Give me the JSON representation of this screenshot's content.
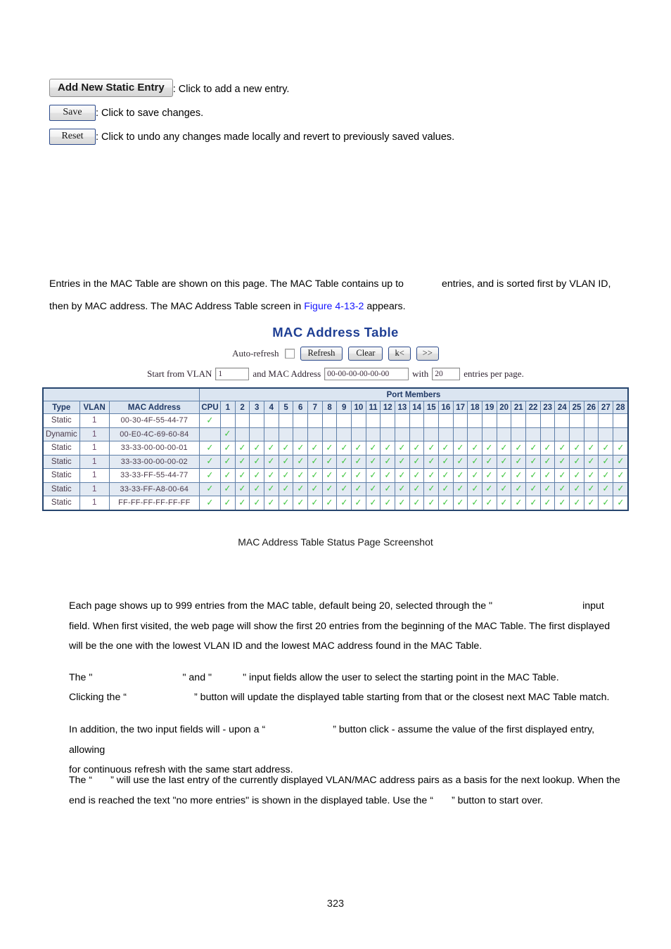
{
  "legend": {
    "items": [
      {
        "button": "Add New Static Entry",
        "style": "classic",
        "desc": ": Click to add a new entry."
      },
      {
        "button": "Save",
        "style": "web",
        "desc": ": Click to save changes."
      },
      {
        "button": "Reset",
        "style": "web",
        "desc": ": Click to undo any changes made locally and revert to previously saved values."
      }
    ]
  },
  "intro": {
    "part1": "Entries in the MAC Table are shown on this page. The MAC Table contains up to",
    "part2": "entries, and is sorted first by VLAN ID,",
    "part3": "then by MAC address. The MAC Address Table screen in",
    "figure_ref": "Figure 4-13-2",
    "part4": "appears."
  },
  "screenshot": {
    "title": "MAC Address Table",
    "controls": {
      "auto_refresh_label": "Auto-refresh",
      "auto_refresh_checked": false,
      "refresh_label": "Refresh",
      "clear_label": "Clear",
      "first_label": "k<",
      "next_label": ">>"
    },
    "filter": {
      "start_label": "Start from VLAN",
      "vlan_value": "1",
      "and_mac_label": "and MAC Address",
      "mac_value": "00-00-00-00-00-00",
      "with_label": "with",
      "entries_value": "20",
      "per_page_label": "entries per page."
    },
    "table": {
      "port_members_label": "Port Members",
      "columns": [
        "Type",
        "VLAN",
        "MAC Address"
      ],
      "cpu_label": "CPU",
      "ports": [
        1,
        2,
        3,
        4,
        5,
        6,
        7,
        8,
        9,
        10,
        11,
        12,
        13,
        14,
        15,
        16,
        17,
        18,
        19,
        20,
        21,
        22,
        23,
        24,
        25,
        26,
        27,
        28
      ],
      "tick_glyph": "✓",
      "rows": [
        {
          "type": "Static",
          "vlan": "1",
          "mac": "00-30-4F-55-44-77",
          "cpu": true,
          "ports": []
        },
        {
          "type": "Dynamic",
          "vlan": "1",
          "mac": "00-E0-4C-69-60-84",
          "cpu": false,
          "ports": [
            1
          ]
        },
        {
          "type": "Static",
          "vlan": "1",
          "mac": "33-33-00-00-00-01",
          "cpu": true,
          "ports": [
            1,
            2,
            3,
            4,
            5,
            6,
            7,
            8,
            9,
            10,
            11,
            12,
            13,
            14,
            15,
            16,
            17,
            18,
            19,
            20,
            21,
            22,
            23,
            24,
            25,
            26,
            27,
            28
          ]
        },
        {
          "type": "Static",
          "vlan": "1",
          "mac": "33-33-00-00-00-02",
          "cpu": true,
          "ports": [
            1,
            2,
            3,
            4,
            5,
            6,
            7,
            8,
            9,
            10,
            11,
            12,
            13,
            14,
            15,
            16,
            17,
            18,
            19,
            20,
            21,
            22,
            23,
            24,
            25,
            26,
            27,
            28
          ]
        },
        {
          "type": "Static",
          "vlan": "1",
          "mac": "33-33-FF-55-44-77",
          "cpu": true,
          "ports": [
            1,
            2,
            3,
            4,
            5,
            6,
            7,
            8,
            9,
            10,
            11,
            12,
            13,
            14,
            15,
            16,
            17,
            18,
            19,
            20,
            21,
            22,
            23,
            24,
            25,
            26,
            27,
            28
          ]
        },
        {
          "type": "Static",
          "vlan": "1",
          "mac": "33-33-FF-A8-00-64",
          "cpu": true,
          "ports": [
            1,
            2,
            3,
            4,
            5,
            6,
            7,
            8,
            9,
            10,
            11,
            12,
            13,
            14,
            15,
            16,
            17,
            18,
            19,
            20,
            21,
            22,
            23,
            24,
            25,
            26,
            27,
            28
          ]
        },
        {
          "type": "Static",
          "vlan": "1",
          "mac": "FF-FF-FF-FF-FF-FF",
          "cpu": true,
          "ports": [
            1,
            2,
            3,
            4,
            5,
            6,
            7,
            8,
            9,
            10,
            11,
            12,
            13,
            14,
            15,
            16,
            17,
            18,
            19,
            20,
            21,
            22,
            23,
            24,
            25,
            26,
            27,
            28
          ]
        }
      ]
    }
  },
  "caption": "MAC Address Table Status Page Screenshot",
  "body": {
    "p_each_1": "Each page shows up to 999 entries from the MAC table, default being 20, selected through the \"",
    "p_each_2": "input",
    "p_each_3": "field. When first visited, the web page will show the first 20 entries from the beginning of the MAC Table. The first displayed",
    "p_each_4": "will be the one with the lowest VLAN ID and the lowest MAC address found in the MAC Table.",
    "p_the_1": "The \"",
    "p_the_2": "\" and \"",
    "p_the_3": "\" input fields allow the user to select the starting point in the MAC Table.",
    "p_click_1": "Clicking the “",
    "p_click_2": "” button will update the displayed table starting from that or the closest next MAC Table match.",
    "p_inadd_1": "In addition, the two input fields will - upon a “",
    "p_inadd_2": "” button click - assume the value of the first displayed entry, allowing",
    "p_inadd_3": "for continuous refresh with the same start address.",
    "p_thewill_1": "The “",
    "p_thewill_2": "” will use the last entry of the currently displayed VLAN/MAC address pairs as a basis for the next lookup. When the",
    "p_thewill_3": "end is reached the text \"no more entries\" is shown in the displayed table. Use the “",
    "p_thewill_4": "” button to start over."
  },
  "page_number": "323",
  "colors": {
    "title_blue": "#1f3f94",
    "link_blue": "#1414ff",
    "table_border": "#26456e",
    "header_bg": "#dbe5f1",
    "zebra_bg": "#e3eaf3",
    "tick_green": "#3ec43e"
  }
}
